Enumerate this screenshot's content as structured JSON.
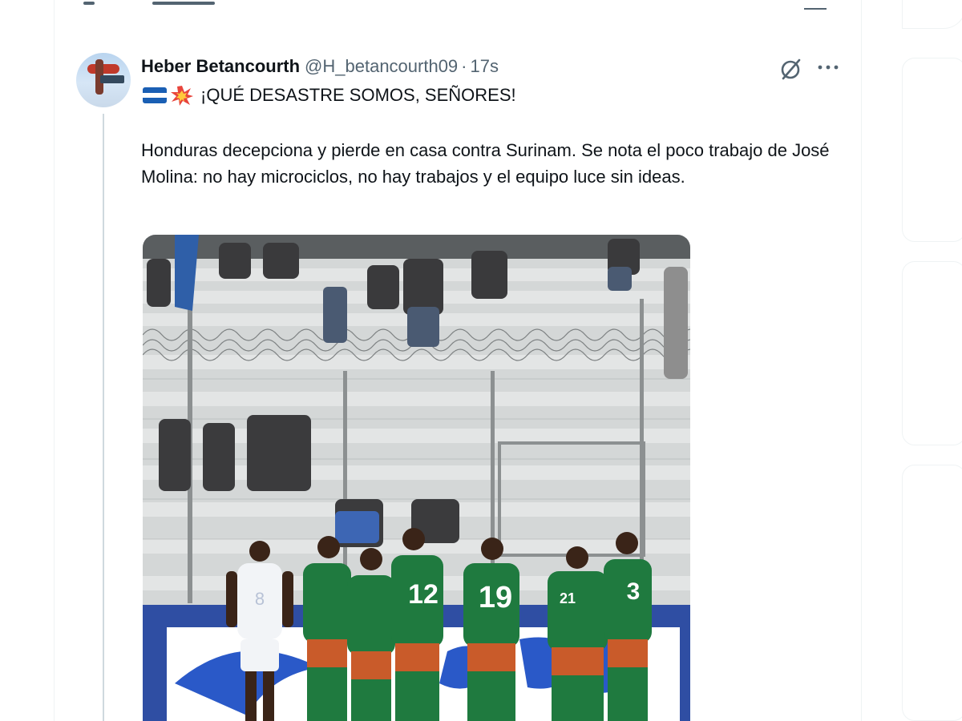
{
  "tweet": {
    "display_name": "Heber Betancourth",
    "handle": "@H_betancourth09",
    "separator": "·",
    "time": "17s",
    "headline": "¡QUÉ DESASTRE SOMOS, SEÑORES!",
    "body": "Honduras decepciona y pierde en casa contra Surinam. Se nota el poco trabajo de José Molina: no hay microciclos, no hay trabajos y el equipo luce sin ideas.",
    "headline_emojis": [
      "honduras-flag",
      "collision"
    ]
  },
  "photo": {
    "jersey_numbers": [
      "8",
      "12",
      "19",
      "3",
      "21"
    ]
  },
  "colors": {
    "text_primary": "#0f1419",
    "text_secondary": "#536471",
    "thread_line": "#cfd9de",
    "honduras_blue": "#1a5fb4",
    "suriname_green": "#1f7a3f",
    "border": "#eff3f4"
  },
  "icons": {
    "grok": "slashed-circle-icon",
    "more": "more-icon"
  }
}
